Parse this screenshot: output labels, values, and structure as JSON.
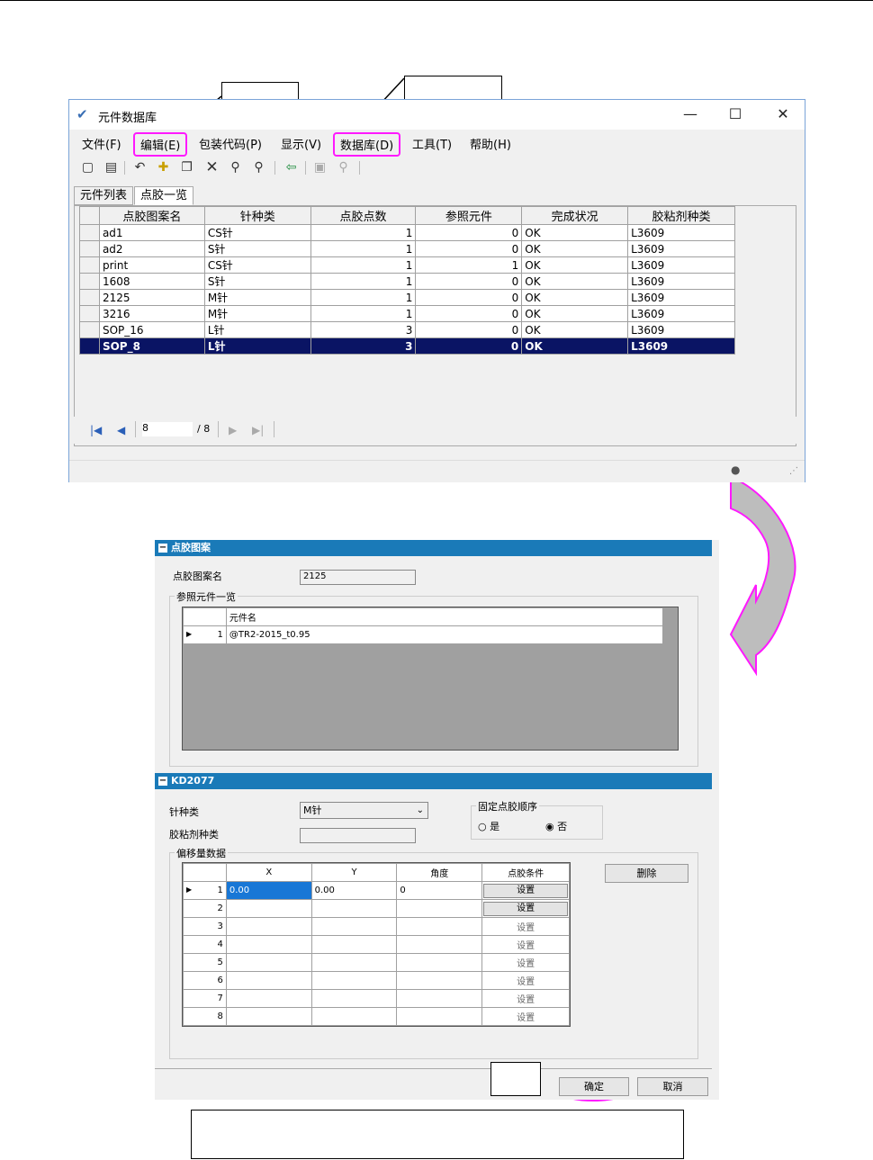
{
  "window": {
    "title": "元件数据库",
    "minimize": "—",
    "maximize": "☐",
    "close": "✕"
  },
  "menu": {
    "file": "文件(F)",
    "edit": "编辑(E)",
    "package_code": "包装代码(P)",
    "view": "显示(V)",
    "database": "数据库(D)",
    "tools": "工具(T)",
    "help": "帮助(H)"
  },
  "tabs": {
    "parts_list": "元件列表",
    "dispense_list": "点胶一览"
  },
  "grid": {
    "headers": [
      "点胶图案名",
      "针种类",
      "点胶点数",
      "参照元件",
      "完成状况",
      "胶粘剂种类"
    ],
    "rows": [
      [
        "ad1",
        "CS针",
        "1",
        "0",
        "OK",
        "L3609"
      ],
      [
        "ad2",
        "S针",
        "1",
        "0",
        "OK",
        "L3609"
      ],
      [
        "print",
        "CS针",
        "1",
        "1",
        "OK",
        "L3609"
      ],
      [
        "1608",
        "S针",
        "1",
        "0",
        "OK",
        "L3609"
      ],
      [
        "2125",
        "M针",
        "1",
        "0",
        "OK",
        "L3609"
      ],
      [
        "3216",
        "M针",
        "1",
        "0",
        "OK",
        "L3609"
      ],
      [
        "SOP_16",
        "L针",
        "3",
        "0",
        "OK",
        "L3609"
      ],
      [
        "SOP_8",
        "L针",
        "3",
        "0",
        "OK",
        "L3609"
      ]
    ],
    "selected_row": 7
  },
  "nav": {
    "current": "8",
    "total": "/ 8"
  },
  "dispense_pattern": {
    "header": "点胶图案",
    "name_label": "点胶图案名",
    "name_value": "2125",
    "ref_list_label": "参照元件一览",
    "ref_col_header": "元件名",
    "ref_rows": [
      {
        "index": "1",
        "name": "@TR2-2015_t0.95"
      }
    ]
  },
  "kd": {
    "header": "KD2077",
    "needle_label": "针种类",
    "needle_value": "M针",
    "adhesive_label": "胶粘剂种类",
    "adhesive_value": "",
    "fixed_order_label": "固定点胶顺序",
    "radio_yes": "是",
    "radio_no": "否",
    "radio_selected": "no",
    "offset_label": "偏移量数据",
    "offset_headers": [
      "X",
      "Y",
      "角度",
      "点胶条件"
    ],
    "set_label": "设置",
    "offset_rows": [
      {
        "index": "1",
        "x": "0.00",
        "y": "0.00",
        "angle": "0"
      },
      {
        "index": "2",
        "x": "",
        "y": "",
        "angle": ""
      },
      {
        "index": "3",
        "x": "",
        "y": "",
        "angle": ""
      },
      {
        "index": "4",
        "x": "",
        "y": "",
        "angle": ""
      },
      {
        "index": "5",
        "x": "",
        "y": "",
        "angle": ""
      },
      {
        "index": "6",
        "x": "",
        "y": "",
        "angle": ""
      },
      {
        "index": "7",
        "x": "",
        "y": "",
        "angle": ""
      },
      {
        "index": "8",
        "x": "",
        "y": "",
        "angle": ""
      }
    ],
    "delete_button": "删除"
  },
  "dialog_buttons": {
    "ok": "确定",
    "cancel": "取消"
  },
  "colors": {
    "highlight": "#ff19ff",
    "selected_row": "#0a1464",
    "section_header": "#1a7ab8",
    "cell_selected": "#1877d6"
  }
}
